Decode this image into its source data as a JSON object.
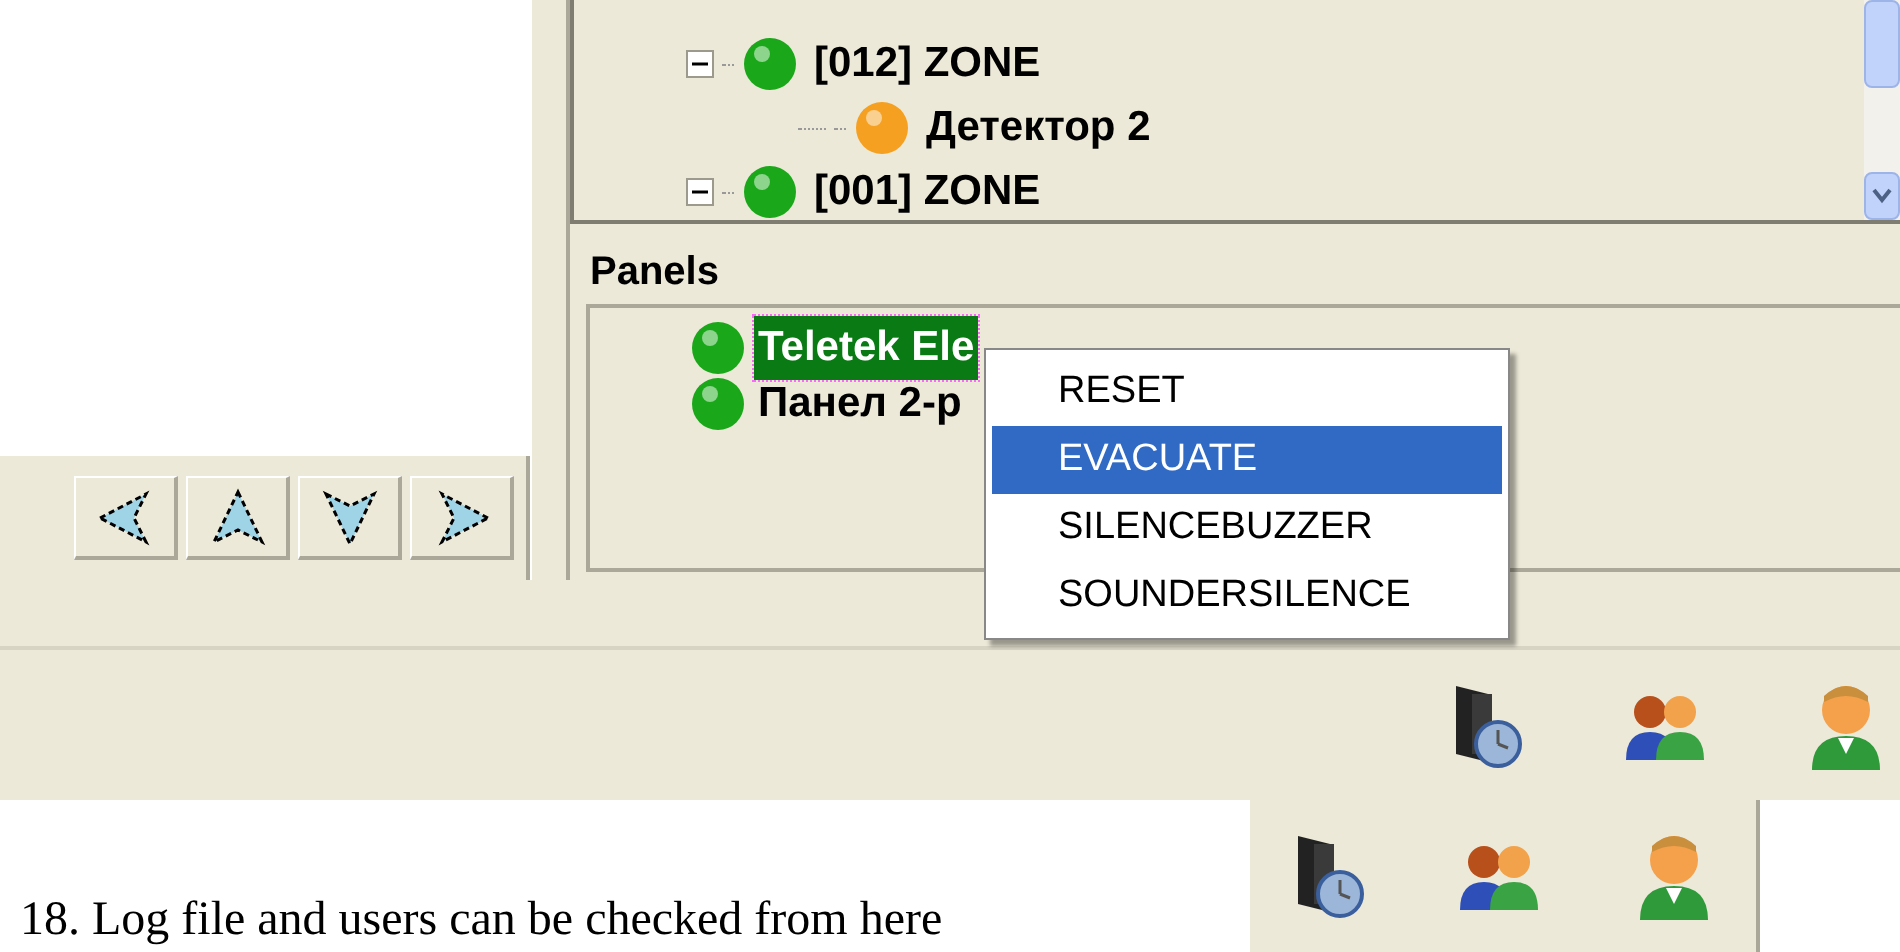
{
  "zone_tree": {
    "items": [
      {
        "label": "[012] ZONE",
        "color": "#1aa81a",
        "expanded": true,
        "children": [
          {
            "label": "Детектор 2",
            "color": "#f5a020"
          }
        ]
      },
      {
        "label": "[001] ZONE",
        "color": "#1aa81a",
        "expanded": true
      }
    ]
  },
  "panels": {
    "title": "Panels",
    "items": [
      {
        "label": "Teletek Ele",
        "color": "#1aa81a",
        "selected": true
      },
      {
        "label": "Панел 2-р",
        "color": "#1aa81a",
        "selected": false
      }
    ]
  },
  "context_menu": {
    "items": [
      {
        "label": "RESET",
        "selected": false
      },
      {
        "label": "EVACUATE",
        "selected": true
      },
      {
        "label": "SILENCEBUZZER",
        "selected": false
      },
      {
        "label": "SOUNDERSILENCE",
        "selected": false
      }
    ]
  },
  "caption": "18. Log file and users can be checked from here"
}
